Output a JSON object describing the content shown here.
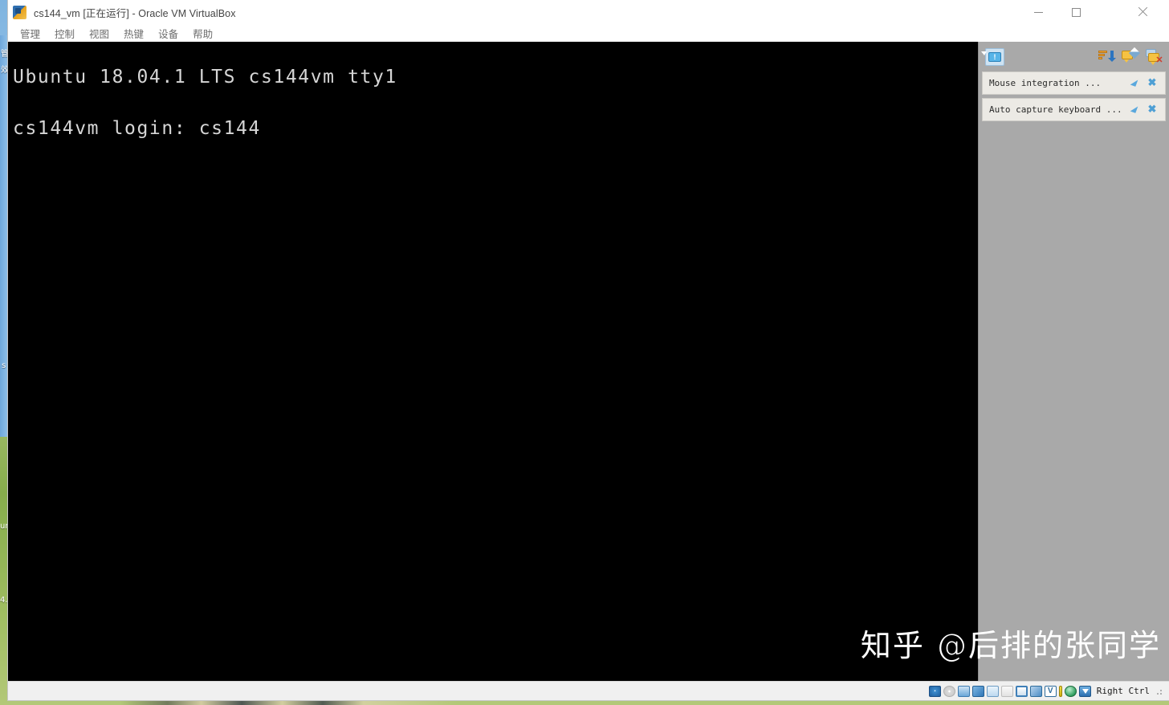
{
  "desktop": {
    "left_glyphs": [
      "管",
      "效",
      "s",
      "url",
      "4."
    ],
    "wallpaper_description": "outdoor-grass-sky"
  },
  "window": {
    "title": "cs144_vm [正在运行] - Oracle VM VirtualBox",
    "app_icon": "virtualbox-icon",
    "controls": {
      "minimize": "minimize-icon",
      "maximize": "maximize-icon",
      "close": "close-icon"
    }
  },
  "menubar": {
    "items": [
      {
        "label": "管理"
      },
      {
        "label": "控制"
      },
      {
        "label": "视图"
      },
      {
        "label": "热键"
      },
      {
        "label": "设备"
      },
      {
        "label": "帮助"
      }
    ]
  },
  "terminal": {
    "lines": [
      "Ubuntu 18.04.1 LTS cs144vm tty1",
      "",
      "cs144vm login: cs144"
    ],
    "background": "#000000",
    "foreground": "#d6d6d6"
  },
  "notifications": {
    "panel_icon": "info-bubble-icon",
    "toolbar": [
      {
        "name": "sort-descending-icon"
      },
      {
        "name": "keep-message-icon"
      },
      {
        "name": "dismiss-all-messages-icon"
      }
    ],
    "items": [
      {
        "text": "Mouse integration ...",
        "actions": [
          {
            "name": "cursor-icon"
          },
          {
            "name": "close-icon"
          }
        ]
      },
      {
        "text": "Auto capture keyboard ...",
        "actions": [
          {
            "name": "cursor-icon"
          },
          {
            "name": "close-icon"
          }
        ]
      }
    ]
  },
  "watermark": {
    "text": "知乎 @后排的张同学"
  },
  "statusbar": {
    "icons": [
      {
        "name": "hard-disk-icon"
      },
      {
        "name": "optical-drive-icon"
      },
      {
        "name": "floppy-drive-icon"
      },
      {
        "name": "network-adapter-icon"
      },
      {
        "name": "usb-icon"
      },
      {
        "name": "shared-folders-icon"
      },
      {
        "name": "display-icon"
      },
      {
        "name": "video-capture-icon"
      },
      {
        "name": "vrde-server-icon"
      },
      {
        "name": "activity-bar-icon"
      },
      {
        "name": "globe-icon"
      },
      {
        "name": "host-key-arrow-icon"
      }
    ],
    "host_key": "Right Ctrl",
    "resize_grip": "resize-grip-icon"
  }
}
